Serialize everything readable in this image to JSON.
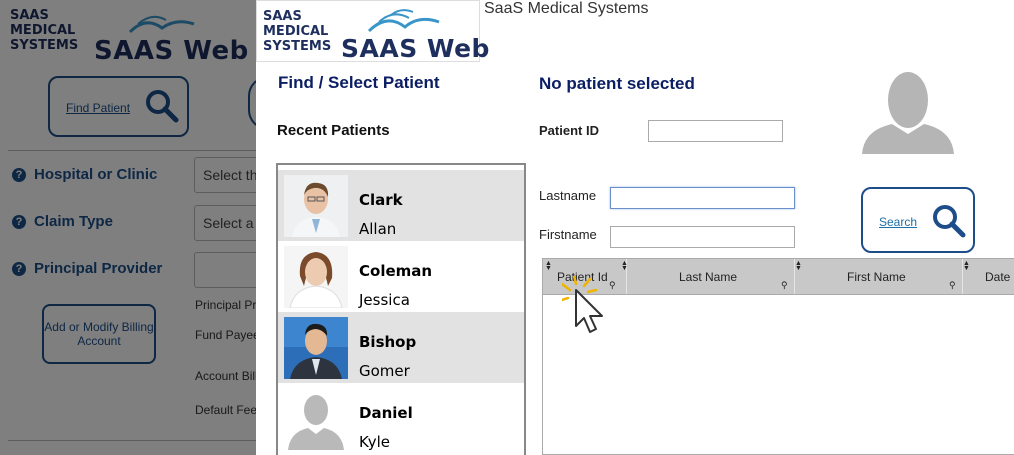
{
  "background": {
    "logo": {
      "line1": "SAAS",
      "line2": "MEDICAL",
      "line3": "SYSTEMS",
      "brand": "SAAS Web"
    },
    "find_patient_label": "Find Patient",
    "fields": [
      {
        "label": "Hospital or Clinic",
        "placeholder": "Select th"
      },
      {
        "label": "Claim Type",
        "placeholder": "Select a"
      },
      {
        "label": "Principal Provider",
        "placeholder": ""
      }
    ],
    "billing_button": "Add or Modify Billing Account",
    "labels": [
      "Principal Pr",
      "Fund Payee",
      "Account Bill",
      "Default Fee"
    ]
  },
  "modal": {
    "logo": {
      "line1": "SAAS",
      "line2": "MEDICAL",
      "line3": "SYSTEMS",
      "brand": "SAAS Web"
    },
    "app_title": "SaaS Medical Systems",
    "find_heading": "Find / Select Patient",
    "recent_heading": "Recent Patients",
    "status_heading": "No patient selected",
    "recent_patients": [
      {
        "last": "Clark",
        "first": "Allan"
      },
      {
        "last": "Coleman",
        "first": "Jessica"
      },
      {
        "last": "Bishop",
        "first": "Gomer"
      },
      {
        "last": "Daniel",
        "first": "Kyle"
      }
    ],
    "form": {
      "patient_id_label": "Patient ID",
      "patient_id_value": "",
      "lastname_label": "Lastname",
      "lastname_value": "",
      "firstname_label": "Firstname",
      "firstname_value": ""
    },
    "search_label": "Search",
    "grid_columns": [
      "Patient Id",
      "Last Name",
      "First Name",
      "Date o"
    ]
  },
  "colors": {
    "navy": "#0b1e63",
    "button_border": "#1d4e89",
    "row_alt": "#e2e2e2",
    "grid_header": "#c8c8c8"
  },
  "icons": [
    "magnifier-icon",
    "person-silhouette-icon",
    "help-circle-icon",
    "sort-arrows-icon",
    "filter-search-icon",
    "pointer-cursor-icon"
  ]
}
